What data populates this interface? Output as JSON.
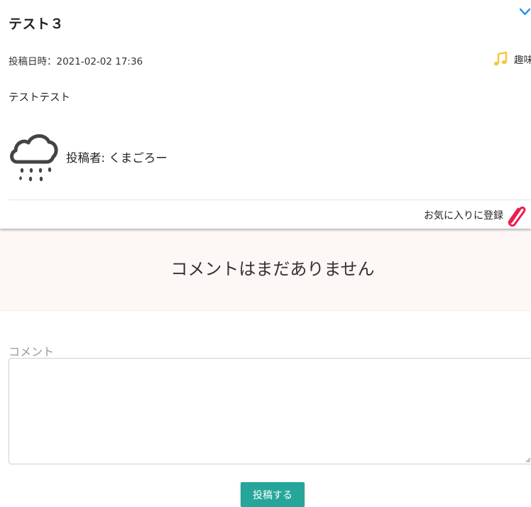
{
  "post": {
    "title": "テスト３",
    "meta_date": "投稿日時：2021-02-02 17:36",
    "category_label": "趣味",
    "body": "テストテスト",
    "author": "投稿者: くまごろー",
    "favorite_label": "お気に入りに登録"
  },
  "comments": {
    "empty_message": "コメントはまだありません",
    "field_label": "コメント",
    "field_value": "",
    "submit_label": "投稿する"
  },
  "icons": {
    "chevron": "chevron-down-icon",
    "category": "music-note-icon",
    "weather": "rain-cloud-icon",
    "favorite": "paperclip-icon"
  },
  "colors": {
    "accent_blue": "#2196f3",
    "music_yellow": "#f7c744",
    "clip_red": "#e91e50",
    "button_teal": "#26a69a",
    "band_bg": "#fdf7f6"
  }
}
